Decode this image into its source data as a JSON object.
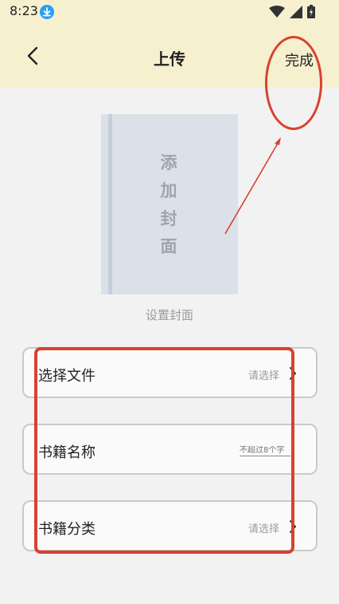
{
  "status_bar": {
    "time": "8:23",
    "icons": [
      "download-icon",
      "wifi-icon",
      "signal-icon",
      "battery-icon"
    ]
  },
  "app_bar": {
    "back_icon": "back-chevron-icon",
    "title": "上传",
    "done_label": "完成"
  },
  "cover": {
    "placeholder_text": "添加封面",
    "caption": "设置封面"
  },
  "form": {
    "fields": [
      {
        "label": "选择文件",
        "value": "请选择",
        "type": "select"
      },
      {
        "label": "书籍名称",
        "placeholder": "不超过8个字",
        "type": "input"
      },
      {
        "label": "书籍分类",
        "value": "请选择",
        "type": "select"
      }
    ]
  },
  "colors": {
    "app_bar_bg": "#f6f0cf",
    "page_bg": "#f2f2f2",
    "annotation": "#d8412f",
    "cover_bg": "#dbe1e8"
  }
}
